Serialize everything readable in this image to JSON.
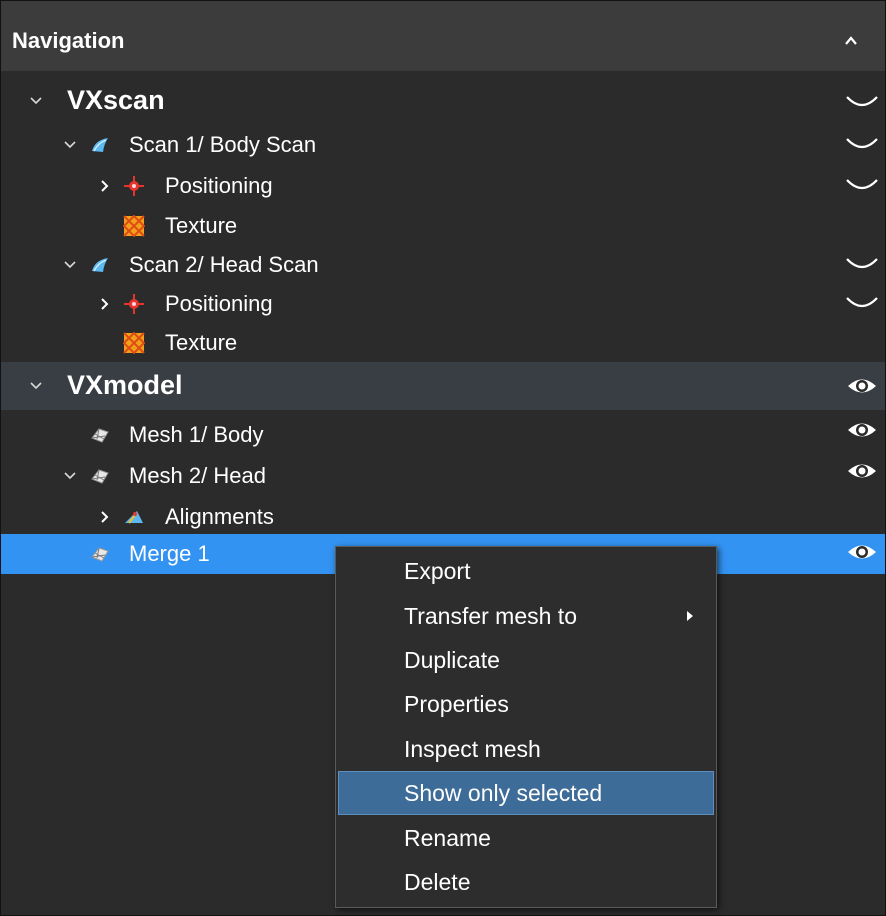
{
  "panel": {
    "title": "Navigation"
  },
  "tree": {
    "vxscan": {
      "label": "VXscan",
      "scan1": {
        "label": "Scan 1/  Body Scan",
        "positioning": "Positioning",
        "texture": "Texture"
      },
      "scan2": {
        "label": "Scan 2/ Head Scan",
        "positioning": "Positioning",
        "texture": "Texture"
      }
    },
    "vxmodel": {
      "label": "VXmodel",
      "mesh1": "Mesh 1/ Body",
      "mesh2": "Mesh 2/ Head",
      "alignments": "Alignments",
      "merge1": "Merge 1"
    }
  },
  "context_menu": {
    "items": [
      "Export",
      "Transfer mesh to",
      "Duplicate",
      "Properties",
      "Inspect mesh",
      "Show only selected",
      "Rename",
      "Delete"
    ],
    "highlighted": "Show only selected"
  },
  "colors": {
    "panel_bg": "#2b2b2b",
    "header_bg": "#3c3c3c",
    "group_row_bg": "#393d44",
    "selection": "#3393f2",
    "menu_highlight": "#3e6c98"
  },
  "icons": {
    "header": "chevron-up-icon",
    "visibility_hidden": "eye-closed-icon",
    "visibility_shown": "eye-icon",
    "scan": "scan-icon",
    "positioning": "positioning-target-icon",
    "texture": "texture-icon",
    "mesh": "mesh-icon",
    "alignments": "alignments-icon",
    "submenu": "submenu-arrow-icon"
  }
}
